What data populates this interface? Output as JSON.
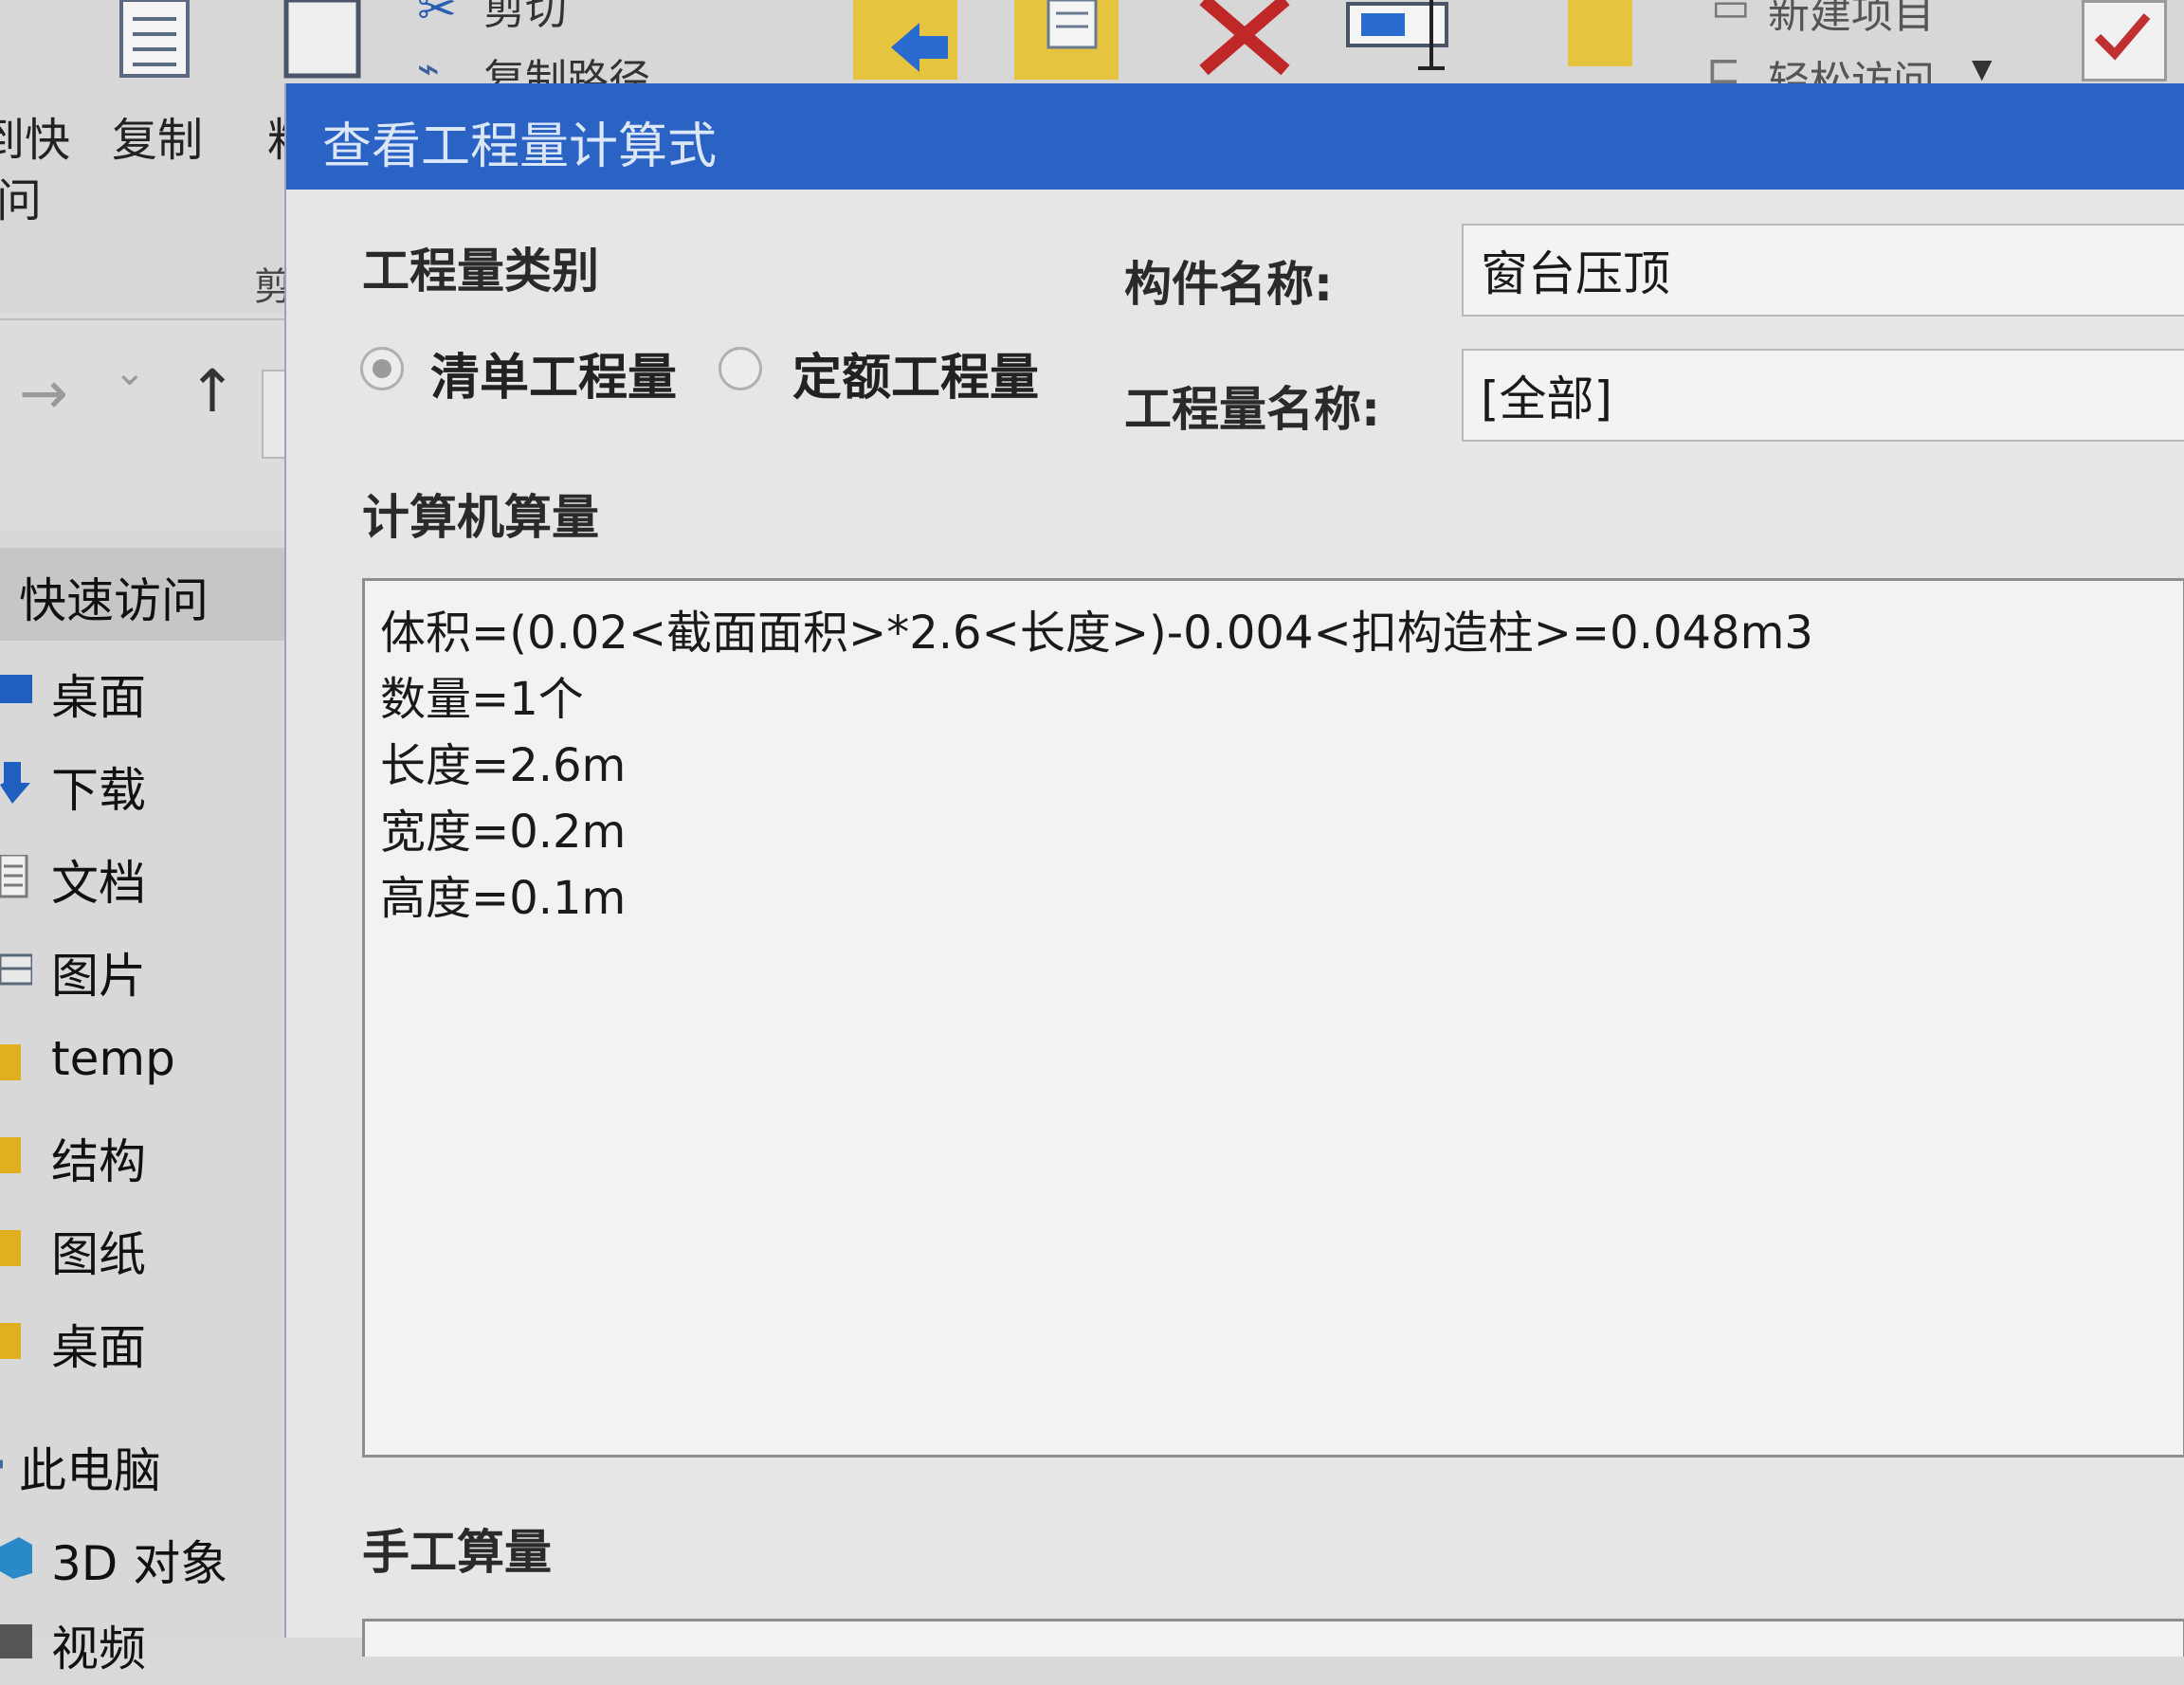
{
  "ribbon": {
    "cut_label": "剪切",
    "copy_path_label": "复制路径",
    "pin_label_line1": "到快",
    "pin_label_line2": "问",
    "copy_label": "复制",
    "paste_partial": "粘",
    "clipboard_partial": "剪",
    "new_item_label": "新建项目",
    "easy_access_label": "轻松访问"
  },
  "nav_buttons": {
    "forward": "→",
    "dropdown": "⌄",
    "up": "↑"
  },
  "sidebar": {
    "quick_access": "快速访问",
    "items": [
      {
        "label": "桌面",
        "icon": "desktop-icon",
        "color": "#1f5fbf"
      },
      {
        "label": "下载",
        "icon": "download-icon",
        "color": "#1f5fbf"
      },
      {
        "label": "文档",
        "icon": "document-icon",
        "color": "#7a7a7a"
      },
      {
        "label": "图片",
        "icon": "pictures-icon",
        "color": "#5a6a7a"
      },
      {
        "label": "temp",
        "icon": "folder-icon",
        "color": "#e0b020"
      },
      {
        "label": "结构",
        "icon": "folder-icon",
        "color": "#e0b020"
      },
      {
        "label": "图纸",
        "icon": "folder-icon",
        "color": "#e0b020"
      },
      {
        "label": "桌面",
        "icon": "folder-icon",
        "color": "#e0b020"
      }
    ],
    "this_pc": "此电脑",
    "pc_items": [
      {
        "label": "3D 对象",
        "icon": "3d-objects-icon",
        "color": "#2a8ac8"
      },
      {
        "label": "视频",
        "icon": "video-icon",
        "color": "#555555"
      }
    ]
  },
  "dialog": {
    "title": "查看工程量计算式",
    "quantity_type_label": "工程量类别",
    "radio_options": [
      {
        "label": "清单工程量",
        "checked": true
      },
      {
        "label": "定额工程量",
        "checked": false
      }
    ],
    "component_name_label": "构件名称:",
    "component_name_value": "窗台压顶",
    "quantity_name_label": "工程量名称:",
    "quantity_name_value": "[全部]",
    "computer_calc_label": "计算机算量",
    "formulas": [
      "体积=(0.02<截面面积>*2.6<长度>)-0.004<扣构造柱>=0.048m3",
      "数量=1个",
      "长度=2.6m",
      "宽度=0.2m",
      "高度=0.1m"
    ],
    "manual_calc_label": "手工算量"
  },
  "colors": {
    "titlebar": "#2b63c4",
    "dialog_bg": "#e6e6e6",
    "explorer_bg": "#dcdcdc",
    "check_accent": "#c03030"
  }
}
